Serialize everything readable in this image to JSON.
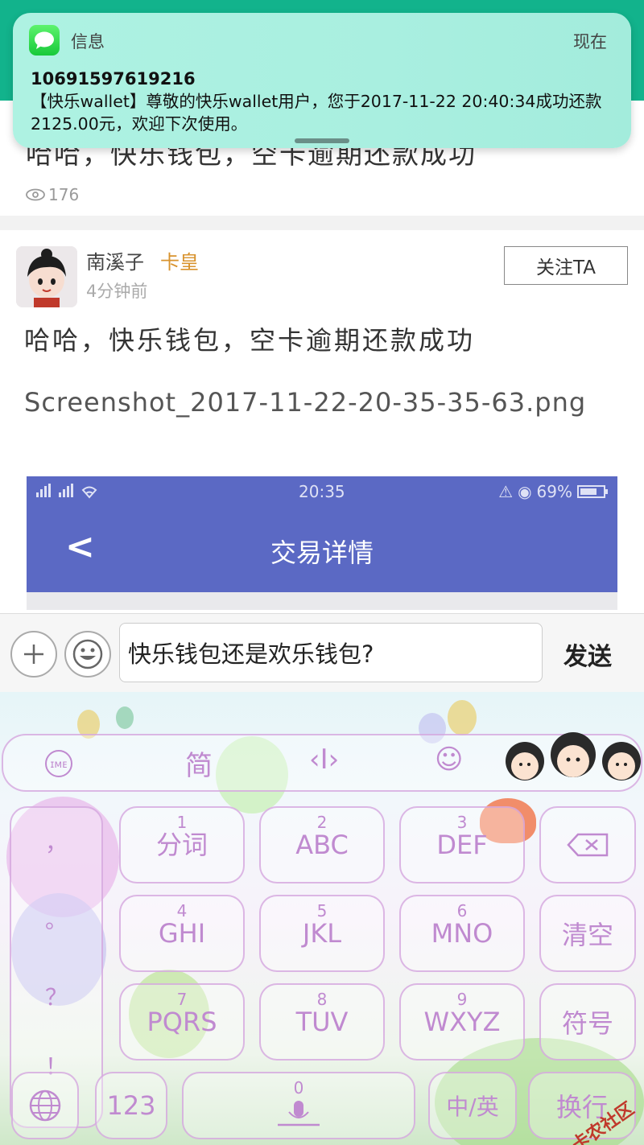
{
  "notification": {
    "app_name": "信息",
    "time": "现在",
    "sender": "10691597619216",
    "body": "【快乐wallet】尊敬的快乐wallet用户，您于2017-11-22 20:40:34成功还款2125.00元，欢迎下次使用。"
  },
  "previous_post": {
    "title": "哈哈，快乐钱包，空卡逾期还款成功",
    "views": "176"
  },
  "post": {
    "author": "南溪子",
    "badge": "卡皇",
    "time": "4分钟前",
    "follow_label": "关注TA",
    "title": "哈哈，快乐钱包，空卡逾期还款成功",
    "filename": "Screenshot_2017-11-22-20-35-35-63.png",
    "embedded_screenshot": {
      "clock": "20:35",
      "battery": "69%",
      "title": "交易详情",
      "back_glyph": "<"
    }
  },
  "comment_bar": {
    "input_value": "快乐钱包还是欢乐钱包?",
    "send_label": "发送"
  },
  "keyboard": {
    "toolbar": {
      "simplified": "简",
      "cursor": "‹I›",
      "emoji": "☺",
      "logo": "(ᵔ‿ᵔ)"
    },
    "punctuation": [
      "，",
      "。",
      "？",
      "！"
    ],
    "keys": [
      {
        "num": "1",
        "label": "分词"
      },
      {
        "num": "2",
        "label": "ABC"
      },
      {
        "num": "3",
        "label": "DEF"
      },
      {
        "num": "4",
        "label": "GHI"
      },
      {
        "num": "5",
        "label": "JKL"
      },
      {
        "num": "6",
        "label": "MNO"
      },
      {
        "num": "7",
        "label": "PQRS"
      },
      {
        "num": "8",
        "label": "TUV"
      },
      {
        "num": "9",
        "label": "WXYZ"
      }
    ],
    "delete_glyph": "⌫",
    "clear_label": "清空",
    "symbol_label": "符号",
    "globe_glyph": "🌐",
    "num_label": "123",
    "space_num": "0",
    "lang_label": "中/英",
    "enter_label": "换行"
  },
  "watermark": "卡农社区",
  "colors": {
    "header_green": "#12b38c",
    "notification_bg": "#a9efe0",
    "embed_blue": "#5b69c4",
    "badge_gold": "#d8932e",
    "key_purple": "#c08ad0"
  }
}
